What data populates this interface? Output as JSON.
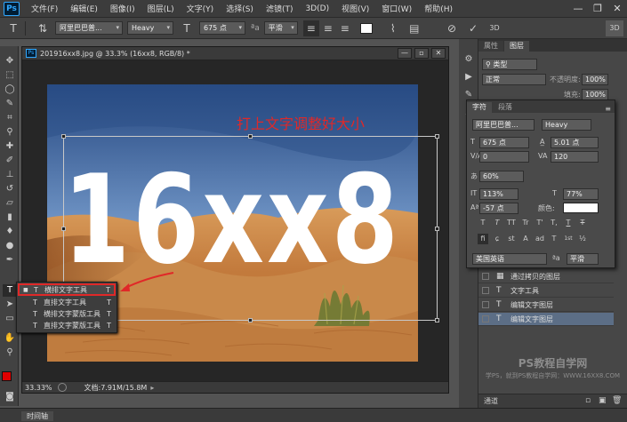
{
  "menubar": {
    "logo": "Ps",
    "items": [
      "文件(F)",
      "编辑(E)",
      "图像(I)",
      "图层(L)",
      "文字(Y)",
      "选择(S)",
      "滤镜(T)",
      "3D(D)",
      "视图(V)",
      "窗口(W)",
      "帮助(H)"
    ],
    "min": "—",
    "restore": "❐",
    "close": "✕"
  },
  "options": {
    "font_family": "阿里巴巴普...",
    "font_style": "Heavy",
    "font_size": "675 点",
    "aa_label": "ªa",
    "aa_mode": "平滑",
    "mode_3d": "3D",
    "mode_3d_right": "3D"
  },
  "document": {
    "title": "201916xx8.jpg @ 33.3% (16xx8, RGB/8) *",
    "canvas_text": "16xx8",
    "annotation": "打上文字调整好大小",
    "zoom": "33.33%",
    "doc_info": "文档:7.91M/15.8M"
  },
  "flyout": {
    "items": [
      {
        "label": "横排文字工具",
        "key": "T"
      },
      {
        "label": "直排文字工具",
        "key": "T"
      },
      {
        "label": "横排文字蒙版工具",
        "key": "T"
      },
      {
        "label": "直排文字蒙版工具",
        "key": "T"
      }
    ]
  },
  "layers_panel": {
    "tabs": [
      "属性",
      "图层"
    ],
    "filter": "类型",
    "blend_mode": "正常",
    "opacity_label": "不透明度:",
    "opacity": "100%",
    "fill_label": "填充:",
    "fill": "100%",
    "layers": [
      {
        "name": "通过拷贝的图层"
      },
      {
        "name": "文字工具"
      },
      {
        "name": "编辑文字图层"
      },
      {
        "name": "编辑文字图层"
      }
    ],
    "channels_tab": "通道"
  },
  "char_panel": {
    "tabs": [
      "字符",
      "段落"
    ],
    "font_family": "阿里巴巴普...",
    "font_style": "Heavy",
    "size": "675 点",
    "leading": "5.01 点",
    "kerning": "0",
    "tracking": "120",
    "scale_v_pct": "60%",
    "vscale": "113%",
    "hscale": "77%",
    "baseline": "-57 点",
    "color_label": "颜色:",
    "language": "美国英语",
    "aa_label": "ªa",
    "aa_mode": "平滑",
    "style_buttons": [
      "T",
      "T",
      "TT",
      "Tr",
      "T'",
      "T,",
      "T",
      "T"
    ],
    "ot_buttons": [
      "fi",
      "ɕ",
      "st",
      "A",
      "ad",
      "T",
      "1st",
      "½"
    ]
  },
  "watermark": {
    "line1": "PS教程自学网",
    "line2": "学PS，就到PS教程自学网：WWW.16XX8.COM"
  },
  "bottom": {
    "timeline": "时间轴"
  },
  "colors": {
    "annotation_red": "#e02828",
    "selection_blue": "#5c6e86",
    "fg_color": "#e00000",
    "bg_color": "#ffffff"
  }
}
